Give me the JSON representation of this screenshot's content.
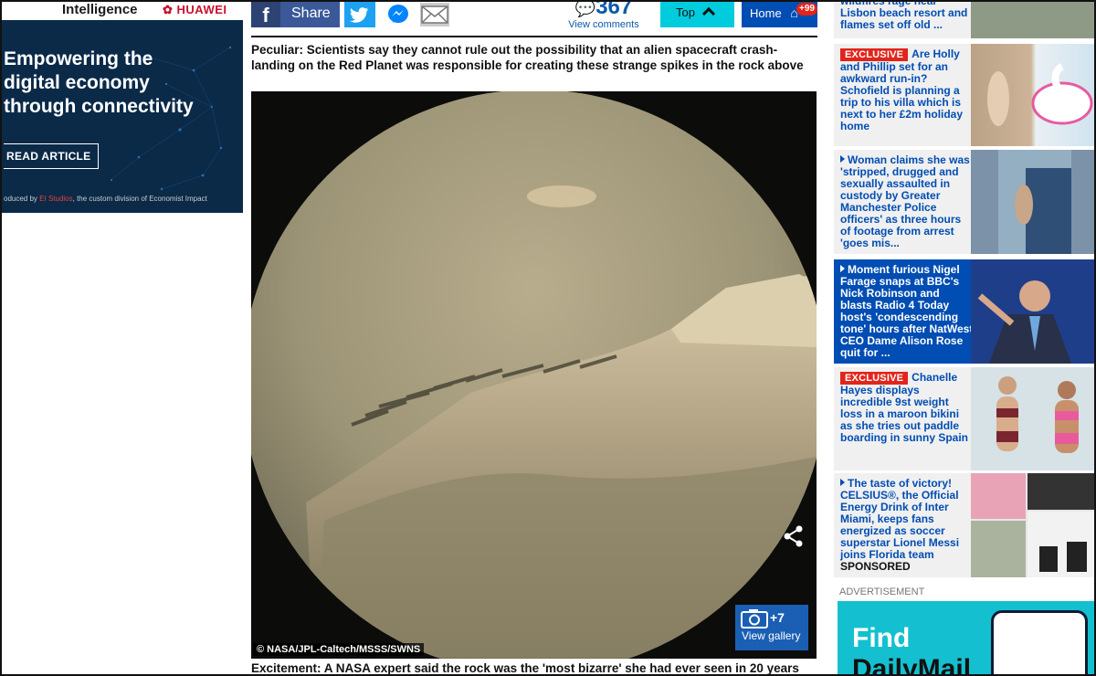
{
  "left_ad": {
    "brand_primary": "Intelligence",
    "brand_secondary": "HUAWEI",
    "headline_lines": [
      "Empowering the",
      "digital economy",
      "through connectivity"
    ],
    "cta": "READ ARTICLE",
    "footer_prefix": "oduced by",
    "footer_highlight": "EI Studios",
    "footer_suffix": ", the custom division of Economist Impact"
  },
  "share_bar": {
    "facebook_label": "Share",
    "comment_count": "367",
    "comment_label": "View comments",
    "top_label": "Top",
    "home_label": "Home",
    "home_badge": "+99"
  },
  "article": {
    "caption_top": "Peculiar: Scientists say they cannot rule out the possibility that an alien spacecraft crash-landing on the Red Planet was responsible for creating these strange spikes in the rock above",
    "photo_credit": "© NASA/JPL-Caltech/MSSS/SWNS",
    "gallery_count": "+7",
    "gallery_label": "View gallery",
    "caption_bottom": "Excitement: A NASA expert said the rock was the 'most bizarre' she had ever seen in 20 years"
  },
  "sidebar": {
    "items": [
      {
        "text": "wildfires rage near Lisbon beach resort and flames set off old ...",
        "exclusive": false,
        "arrow": false
      },
      {
        "text": "Are Holly and Phillip set for an awkward run-in? Schofield is planning a trip to his villa which is next to her £2m holiday home",
        "exclusive": true,
        "arrow": false
      },
      {
        "text": "Woman claims she was 'stripped, drugged and sexually assaulted in custody by Greater Manchester Police officers' as three hours of footage from arrest 'goes mis...",
        "exclusive": false,
        "arrow": true
      },
      {
        "text": "Moment furious Nigel Farage snaps at BBC's Nick Robinson and blasts Radio 4 Today host's 'condescending tone' hours after NatWest CEO Dame Alison Rose quit for ...",
        "exclusive": false,
        "arrow": true
      },
      {
        "text": "Chanelle Hayes displays incredible 9st weight loss in a maroon bikini as she tries out paddle boarding in sunny Spain",
        "exclusive": true,
        "arrow": false
      },
      {
        "text": "The taste of victory! CELSIUS®, the Official Energy Drink of Inter Miami, keeps fans energized as soccer superstar Lionel Messi joins Florida team",
        "exclusive": false,
        "arrow": true,
        "sponsored": "SPONSORED"
      }
    ],
    "exclusive_label": "EXCLUSIVE",
    "advertisement_label": "ADVERTISEMENT",
    "ad_line1": "Find",
    "ad_line2": "DailyMail"
  }
}
